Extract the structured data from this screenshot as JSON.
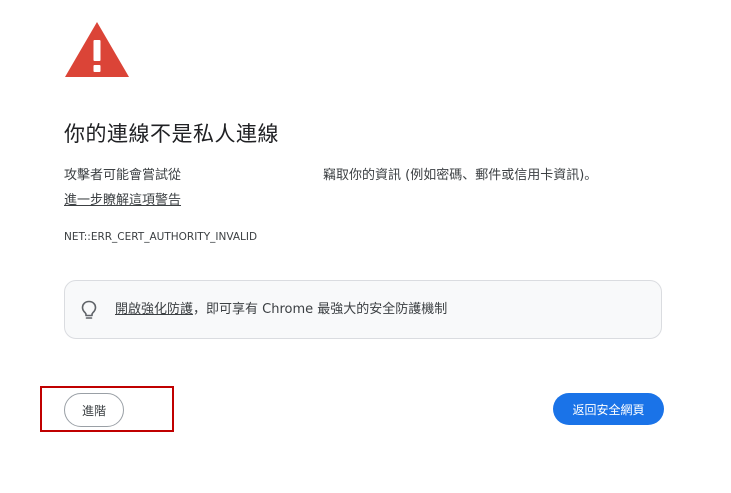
{
  "warning_icon": "warning-triangle-icon",
  "colors": {
    "warning_red": "#db4437",
    "primary_blue": "#1a73e8",
    "highlight_red": "#c00000"
  },
  "heading": "你的連線不是私人連線",
  "body": {
    "before": "攻擊者可能會嘗試從",
    "after": "竊取你的資訊 (例如密碼、郵件或信用卡資訊)。"
  },
  "learn_more_link": "進一步瞭解這項警告",
  "error_code": "NET::ERR_CERT_AUTHORITY_INVALID",
  "callout": {
    "icon": "lightbulb-icon",
    "link_text": "開啟強化防護",
    "rest_text": "，即可享有 Chrome 最強大的安全防護機制"
  },
  "buttons": {
    "advanced": "進階",
    "back_to_safety": "返回安全網頁"
  }
}
